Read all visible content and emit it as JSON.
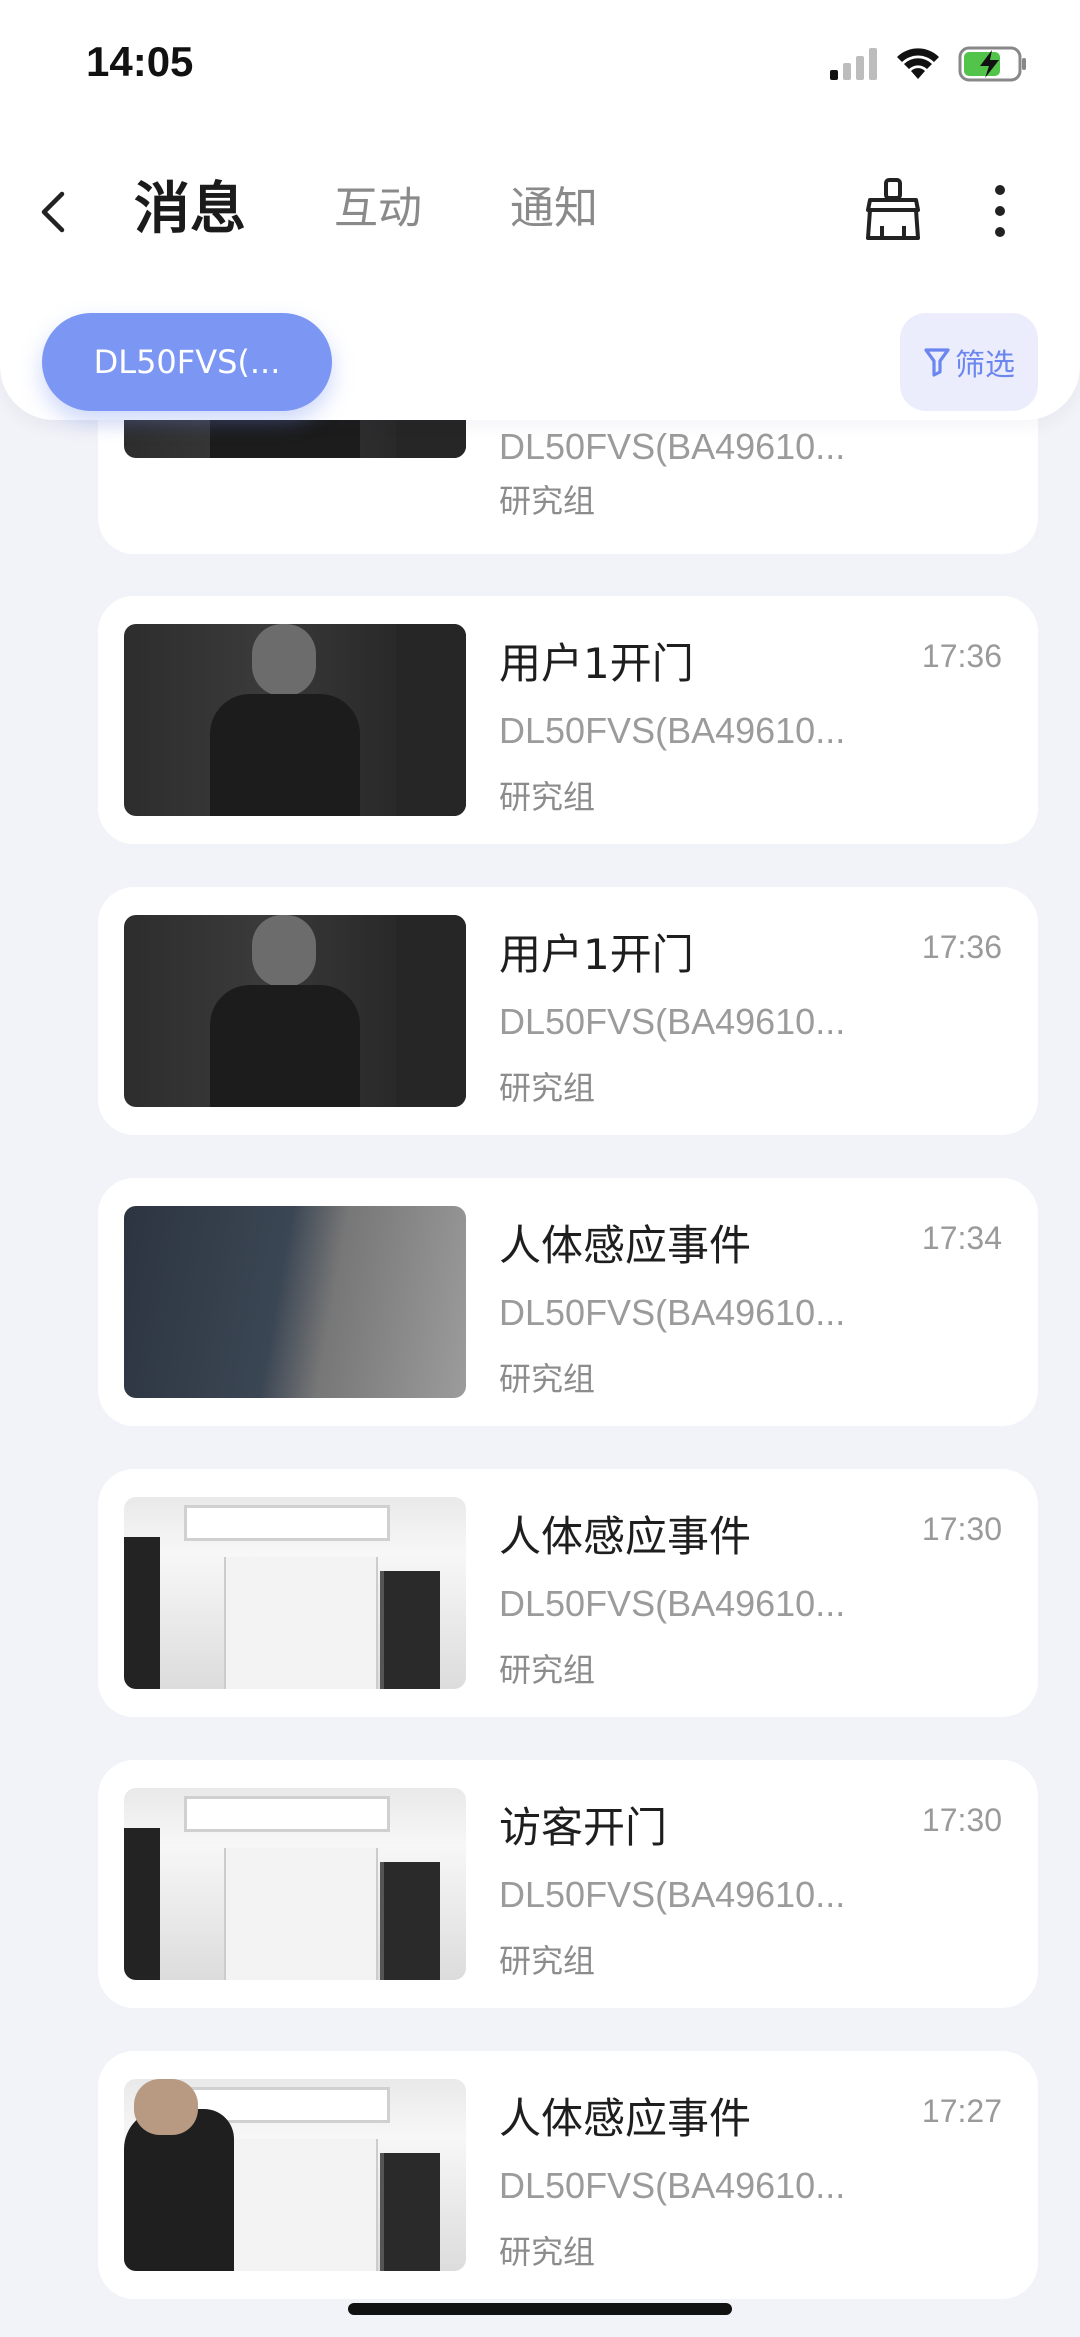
{
  "status_bar": {
    "time": "14:05"
  },
  "header": {
    "tabs": [
      {
        "label": "消息",
        "active": true
      },
      {
        "label": "互动",
        "active": false
      },
      {
        "label": "通知",
        "active": false
      }
    ],
    "device_chip": "DL50FVS(...",
    "filter_label": "筛选"
  },
  "partial_card": {
    "device": "DL50FVS(BA49610...",
    "group": "研究组"
  },
  "messages": [
    {
      "title": "用户1开门",
      "time": "17:36",
      "device": "DL50FVS(BA49610...",
      "group": "研究组"
    },
    {
      "title": "用户1开门",
      "time": "17:36",
      "device": "DL50FVS(BA49610...",
      "group": "研究组"
    },
    {
      "title": "人体感应事件",
      "time": "17:34",
      "device": "DL50FVS(BA49610...",
      "group": "研究组"
    },
    {
      "title": "人体感应事件",
      "time": "17:30",
      "device": "DL50FVS(BA49610...",
      "group": "研究组"
    },
    {
      "title": "访客开门",
      "time": "17:30",
      "device": "DL50FVS(BA49610...",
      "group": "研究组"
    },
    {
      "title": "人体感应事件",
      "time": "17:27",
      "device": "DL50FVS(BA49610...",
      "group": "研究组"
    }
  ],
  "colors": {
    "accent": "#7c96f3",
    "background": "#f2f3f8",
    "card": "#ffffff"
  },
  "icons": [
    "back-arrow-icon",
    "clean-brush-icon",
    "more-vertical-icon",
    "filter-funnel-icon",
    "cellular-signal-icon",
    "wifi-icon",
    "battery-charging-icon"
  ]
}
